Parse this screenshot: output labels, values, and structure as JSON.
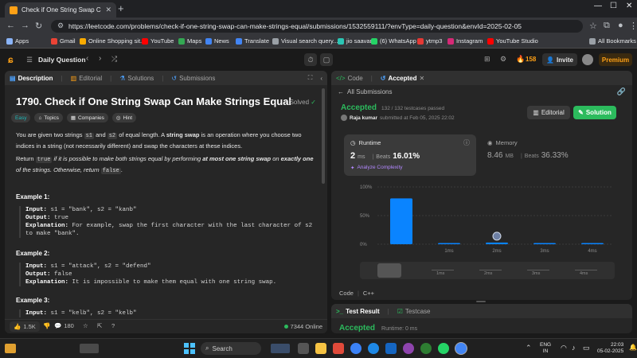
{
  "browser": {
    "tab_title": "Check if One String Swap Can M",
    "url": "https://leetcode.com/problems/check-if-one-string-swap-can-make-strings-equal/submissions/1532559111/?envType=daily-question&envId=2025-02-05",
    "bookmarks": [
      {
        "label": "Apps",
        "color": "#8ab4f8"
      },
      {
        "label": "Gmail",
        "color": "#ea4335"
      },
      {
        "label": "Online Shopping sit...",
        "color": "#f9ab00"
      },
      {
        "label": "YouTube",
        "color": "#ff0000"
      },
      {
        "label": "Maps",
        "color": "#34a853"
      },
      {
        "label": "News",
        "color": "#4285f4"
      },
      {
        "label": "Translate",
        "color": "#4285f4"
      },
      {
        "label": "Visual search query...",
        "color": "#9aa0a6"
      },
      {
        "label": "jio saavan",
        "color": "#2bc5b4"
      },
      {
        "label": "(6) WhatsApp",
        "color": "#25d366"
      },
      {
        "label": "ytmp3",
        "color": "#e53935"
      },
      {
        "label": "Instagram",
        "color": "#d62976"
      },
      {
        "label": "YouTube Studio",
        "color": "#ff0000"
      }
    ],
    "all_bookmarks": "All Bookmarks"
  },
  "header": {
    "daily_question": "Daily Question",
    "streak": "158",
    "invite": "Invite",
    "premium": "Premium"
  },
  "left_panel": {
    "tabs": [
      "Description",
      "Editorial",
      "Solutions",
      "Submissions"
    ],
    "title": "1790. Check if One String Swap Can Make Strings Equal",
    "solved": "Solved",
    "chips": [
      "Easy",
      "Topics",
      "Companies",
      "Hint"
    ],
    "para1_a": "You are given two strings ",
    "s1": "s1",
    "para1_b": " and ",
    "s2": "s2",
    "para1_c": " of equal length. A ",
    "string_swap": "string swap",
    "para1_d": " is an operation where you choose two indices in a string (not necessarily different) and swap the characters at these indices.",
    "para2_a": "Return ",
    "true_kw": "true",
    "para2_b": " if it is possible to make both strings equal by performing ",
    "at_most": "at most one string swap",
    "para2_c": " on ",
    "exactly_one": "exactly one",
    "para2_d": " of the strings. Otherwise, return ",
    "false_kw": "false",
    "para2_e": ".",
    "examples": [
      {
        "title": "Example 1:",
        "input": "s1 = \"bank\", s2 = \"kanb\"",
        "output": "true",
        "explanation": "For example, swap the first character with the last character of s2 to make \"bank\"."
      },
      {
        "title": "Example 2:",
        "input": "s1 = \"attack\", s2 = \"defend\"",
        "output": "false",
        "explanation": "It is impossible to make them equal with one string swap."
      },
      {
        "title": "Example 3:",
        "input": "s1 = \"kelb\", s2 = \"kelb\""
      }
    ],
    "labels": {
      "input": "Input:",
      "output": "Output:",
      "explanation": "Explanation:"
    },
    "likes": "1.5K",
    "comments": "180",
    "online": "7344 Online"
  },
  "right_panel": {
    "tabs": [
      "Code",
      "Accepted"
    ],
    "all_submissions": "All Submissions",
    "status": "Accepted",
    "testcases": "132 / 132 testcases passed",
    "user": "Raja kumar",
    "submitted": "submitted at Feb 05, 2025 22:02",
    "editorial_btn": "Editorial",
    "solution_btn": "Solution",
    "runtime_label": "Runtime",
    "runtime_value": "2",
    "runtime_unit": "ms",
    "beats_label": "Beats",
    "runtime_beats": "16.01%",
    "analyze": "Analyze Complexity",
    "memory_label": "Memory",
    "memory_value": "8.46",
    "memory_unit": "MB",
    "memory_beats": "36.33%",
    "code_label": "Code",
    "lang": "C++",
    "test_result": "Test Result",
    "testcase": "Testcase",
    "bottom_status": "Accepted",
    "bottom_runtime": "Runtime: 0 ms"
  },
  "chart_data": {
    "type": "bar",
    "y_ticks": [
      "100%",
      "50%",
      "0%"
    ],
    "ylim": [
      0,
      100
    ],
    "categories": [
      "",
      "1ms",
      "2ms",
      "3ms",
      "4ms"
    ],
    "values": [
      80,
      2,
      3,
      2,
      2
    ],
    "highlight_index": 2,
    "color": "#0a84ff"
  },
  "taskbar": {
    "search": "Search",
    "lang1": "ENG",
    "lang2": "IN",
    "time": "22:03",
    "date": "05-02-2025"
  },
  "colors": {
    "accent": "#ffa116",
    "accepted": "#2cbb5d",
    "bar": "#0a84ff"
  }
}
